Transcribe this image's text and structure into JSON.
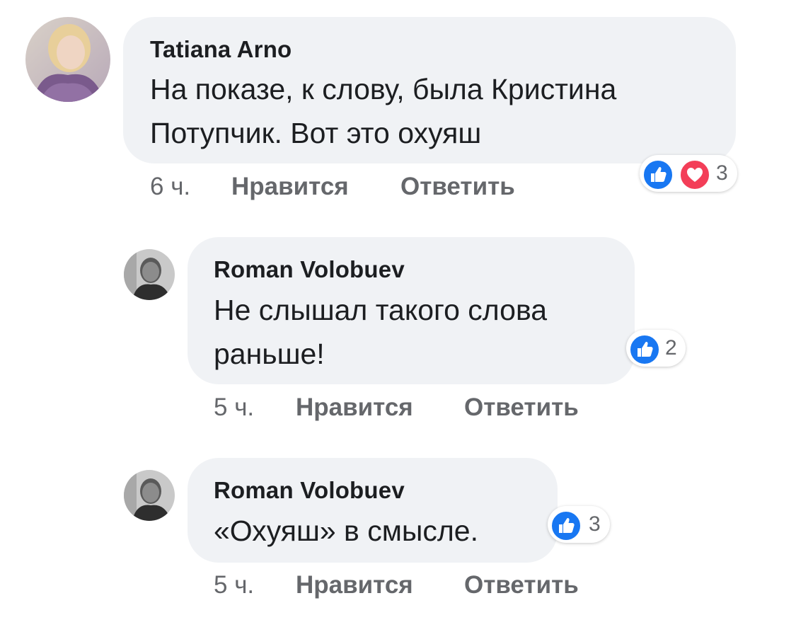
{
  "colors": {
    "bubble": "#f0f2f5",
    "like": "#1877f2",
    "love": "#f33e58",
    "meta_text": "#65676b"
  },
  "actions": {
    "like_label": "Нравится",
    "reply_label": "Ответить"
  },
  "comments": [
    {
      "author": "Tatiana Arno",
      "text": "На показе, к слову, была Кристина\nПотупчик. Вот это охуяш",
      "time": "6 ч.",
      "reactions": [
        "like-icon",
        "love-icon"
      ],
      "reaction_count": "3"
    },
    {
      "author": "Roman Volobuev",
      "text": "Не слышал такого слова\nраньше!",
      "time": "5 ч.",
      "reactions": [
        "like-icon"
      ],
      "reaction_count": "2"
    },
    {
      "author": "Roman Volobuev",
      "text": "«Охуяш» в смысле.",
      "time": "5 ч.",
      "reactions": [
        "like-icon"
      ],
      "reaction_count": "3"
    }
  ]
}
